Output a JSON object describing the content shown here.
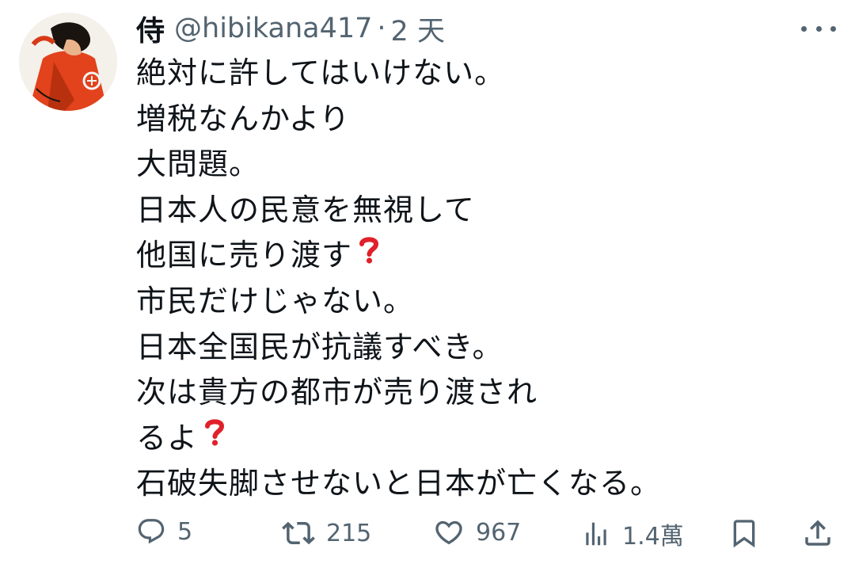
{
  "tweet": {
    "display_name": "侍",
    "handle": "@hibikana417",
    "separator": "·",
    "timestamp": "2 天",
    "lines": [
      "絶対に許してはいけない。",
      "増税なんかより",
      "大問題。",
      "日本人の民意を無視して",
      "他国に売り渡す",
      "市民だけじゃない。",
      "日本全国民が抗議すべき。",
      "次は貴方の都市が売り渡され",
      "るよ",
      "石破失脚させないと日本が亡くなる。"
    ]
  },
  "actions": {
    "reply_count": "5",
    "retweet_count": "215",
    "like_count": "967",
    "view_count": "1.4萬"
  },
  "icons": {
    "reply": "reply-icon",
    "retweet": "retweet-icon",
    "like": "heart-icon",
    "views": "views-icon",
    "bookmark": "bookmark-icon",
    "share": "share-icon",
    "more": "more-icon",
    "question": "question-mark-emoji"
  },
  "colors": {
    "text": "#0f1419",
    "secondary": "#536471",
    "emoji_red": "#e0202a"
  }
}
